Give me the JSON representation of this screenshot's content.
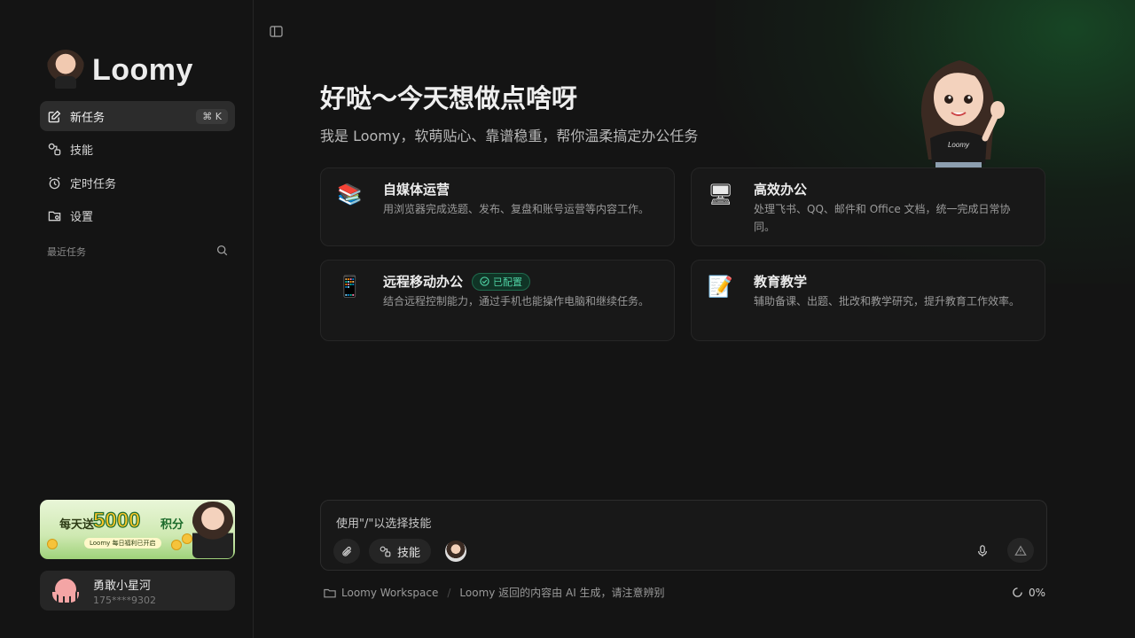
{
  "sidebar": {
    "brand": "Loomy",
    "nav": [
      {
        "label": "新任务",
        "shortcut": "⌘ K",
        "icon": "edit-icon"
      },
      {
        "label": "技能",
        "icon": "skills-icon"
      },
      {
        "label": "定时任务",
        "icon": "alarm-icon"
      },
      {
        "label": "设置",
        "icon": "settings-icon"
      }
    ],
    "recent_label": "最近任务",
    "promo": {
      "prefix": "每天送",
      "number": "5000",
      "unit": "积分",
      "subtitle": "Loomy 每日福利已开启"
    },
    "user": {
      "name": "勇敢小星河",
      "phone": "175****9302"
    }
  },
  "main": {
    "greeting": "好哒～今天想做点啥呀",
    "subtitle": "我是 Loomy，软萌贴心、靠谱稳重，帮你温柔搞定办公任务",
    "mascot_shirt": "Loomy",
    "cards": [
      {
        "emoji": "📚",
        "title": "自媒体运营",
        "desc": "用浏览器完成选题、发布、复盘和账号运营等内容工作。"
      },
      {
        "emoji": "🖥",
        "title": "高效办公",
        "desc": "处理飞书、QQ、邮件和 Office 文档，统一完成日常协同。"
      },
      {
        "emoji": "📱",
        "title": "远程移动办公",
        "badge": "已配置",
        "desc": "结合远程控制能力，通过手机也能操作电脑和继续任务。"
      },
      {
        "emoji": "📝",
        "title": "教育教学",
        "desc": "辅助备课、出题、批改和教学研究，提升教育工作效率。"
      }
    ],
    "composer": {
      "placeholder": "使用\"/\"以选择技能",
      "skill_label": "技能"
    },
    "footer": {
      "workspace": "Loomy Workspace",
      "notice": "Loomy 返回的内容由 AI 生成，请注意辨别",
      "progress": "0%"
    }
  },
  "colors": {
    "accent_green": "#4fd1a3",
    "background": "#141414",
    "promo_gold": "#ffc629"
  }
}
